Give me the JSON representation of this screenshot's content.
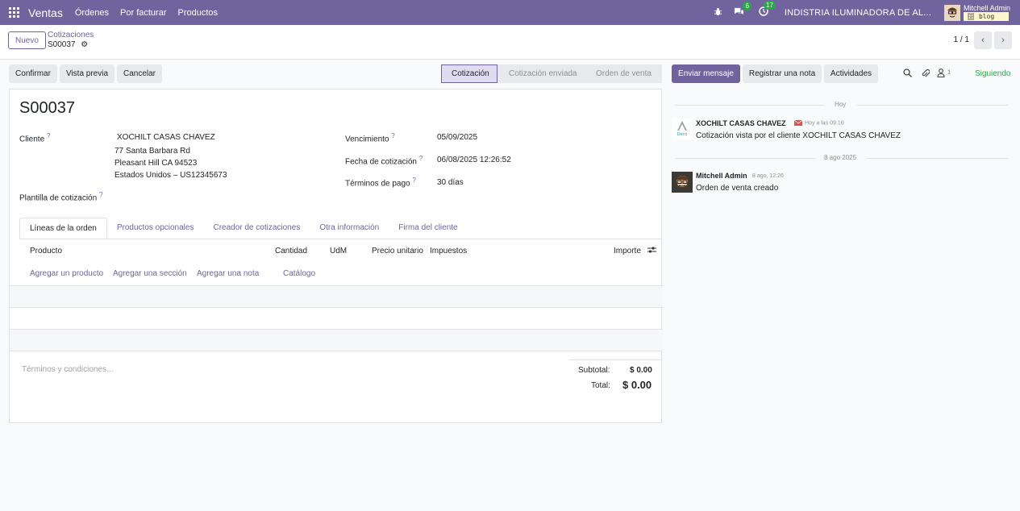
{
  "navbar": {
    "app_name": "Ventas",
    "menu": [
      "Órdenes",
      "Por facturar",
      "Productos"
    ],
    "messages_count": "6",
    "activities_count": "17",
    "company": "INDISTRIA ILUMINADORA DE AL...",
    "user_name": "Mitchell Admin",
    "database": "blog"
  },
  "control": {
    "new_label": "Nuevo",
    "breadcrumb_parent": "Cotizaciones",
    "breadcrumb_current": "S00037",
    "pager": "1 / 1"
  },
  "actions": {
    "confirm": "Confirmar",
    "preview": "Vista previa",
    "cancel": "Cancelar"
  },
  "status_steps": [
    "Cotización",
    "Cotización enviada",
    "Orden de venta"
  ],
  "form": {
    "title": "S00037",
    "customer_label": "Cliente",
    "customer_name": "XOCHILT CASAS CHAVEZ",
    "address_line1": "77 Santa Barbara Rd",
    "address_line2": "Pleasant Hill CA 94523",
    "address_line3": "Estados Unidos – US12345673",
    "template_label": "Plantilla de cotización",
    "expiration_label": "Vencimiento",
    "expiration_value": "05/09/2025",
    "quote_date_label": "Fecha de cotización",
    "quote_date_value": "06/08/2025 12:26:52",
    "payment_terms_label": "Términos de pago",
    "payment_terms_value": "30 días",
    "help_mark": "?"
  },
  "tabs": [
    "Líneas de la orden",
    "Productos opcionales",
    "Creador de cotizaciones",
    "Otra información",
    "Firma del cliente"
  ],
  "lines": {
    "columns": [
      "Producto",
      "Cantidad",
      "UdM",
      "Precio unitario",
      "Impuestos",
      "Importe"
    ],
    "add_product": "Agregar un producto",
    "add_section": "Agregar una sección",
    "add_note": "Agregar una nota",
    "catalog": "Catálogo"
  },
  "terms_placeholder": "Términos y condiciones...",
  "totals": {
    "subtotal_label": "Subtotal:",
    "subtotal_value": "$ 0.00",
    "total_label": "Total:",
    "total_value": "$ 0.00"
  },
  "chatter": {
    "send_message": "Enviar mensaje",
    "log_note": "Registrar una nota",
    "activities": "Actividades",
    "followers_count": "1",
    "following": "Siguiendo",
    "sep_today": "Hoy",
    "sep_date": "8 ago 2025",
    "messages": [
      {
        "author": "XOCHILT CASAS CHAVEZ",
        "date": "Hoy a las 09:10",
        "body": "Cotización vista por el cliente XOCHILT CASAS CHAVEZ"
      },
      {
        "author": "Mitchell Admin",
        "date": "8 ago, 12:26",
        "body": "Orden de venta creado"
      }
    ]
  },
  "colors": {
    "brand": "#71639e",
    "success": "#28a745"
  }
}
